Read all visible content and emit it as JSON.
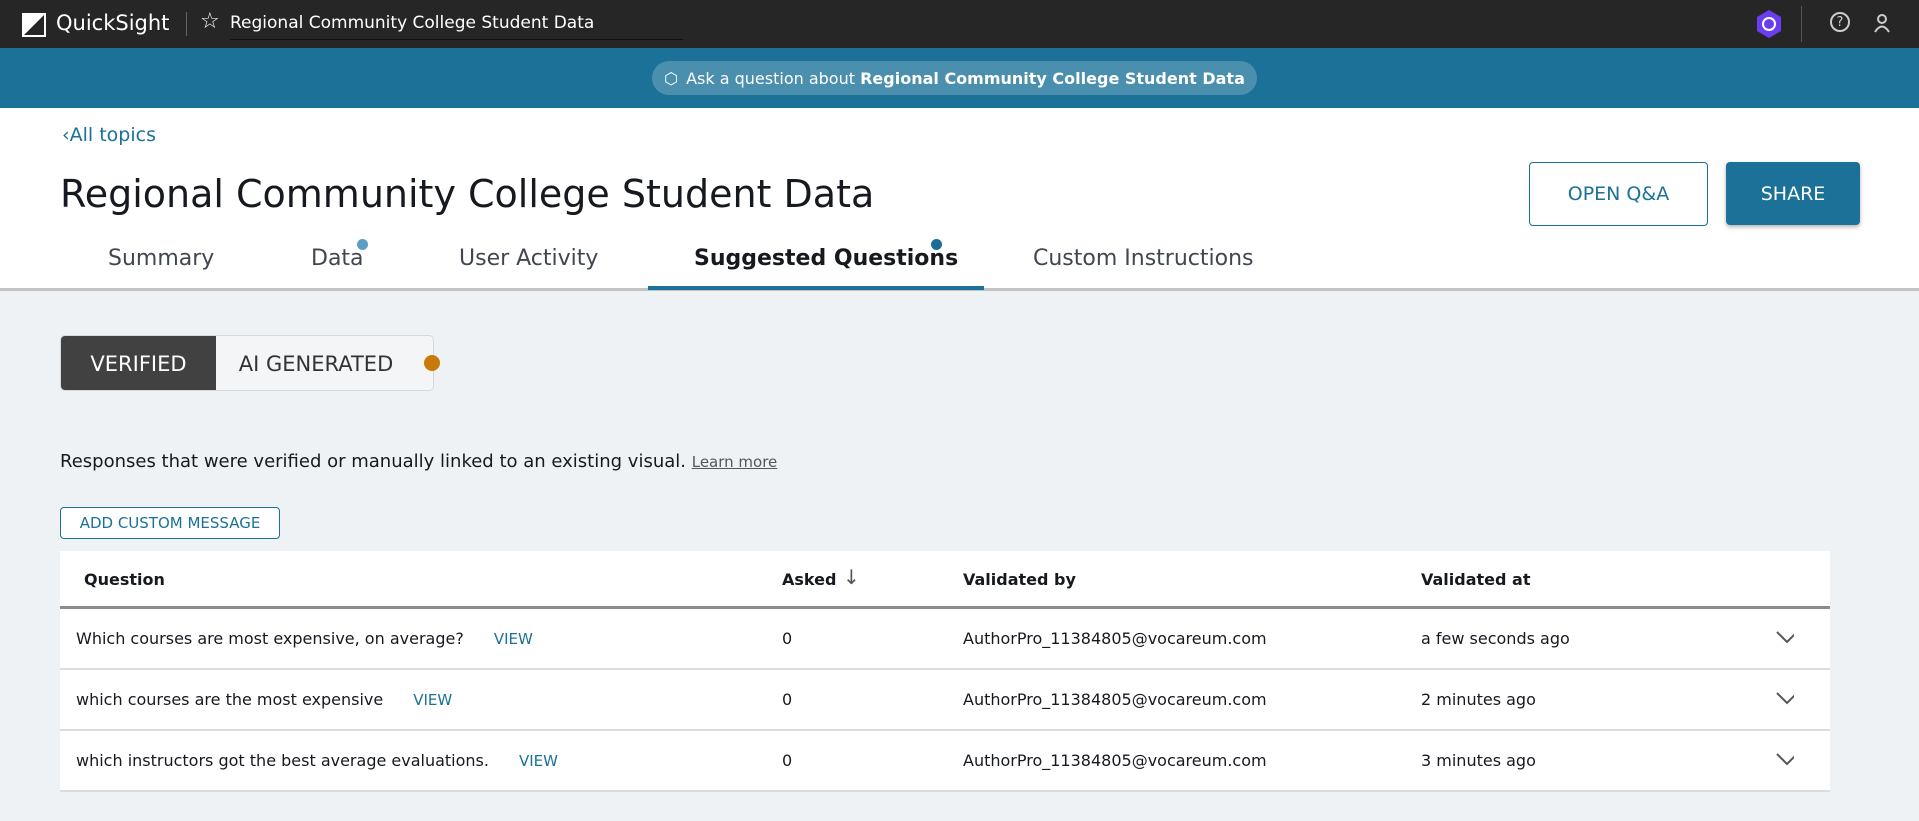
{
  "topbar": {
    "app_name": "QuickSight",
    "doc_title": "Regional Community College Student Data"
  },
  "banner": {
    "prefix": "Ask a question about ",
    "topic": "Regional Community College Student Data"
  },
  "back_link": "All topics",
  "page_title": "Regional Community College Student Data",
  "buttons": {
    "open_qa": "OPEN Q&A",
    "share": "SHARE"
  },
  "tabs": [
    {
      "label": "Summary"
    },
    {
      "label": "Data"
    },
    {
      "label": "User Activity"
    },
    {
      "label": "Suggested Questions",
      "active": true
    },
    {
      "label": "Custom Instructions"
    }
  ],
  "toggle": {
    "verified": "VERIFIED",
    "ai_generated": "AI GENERATED"
  },
  "description": "Responses that were verified or manually linked to an existing visual.",
  "learn_more": "Learn more",
  "add_custom_message": "ADD CUSTOM MESSAGE",
  "table": {
    "headers": {
      "question": "Question",
      "asked": "Asked",
      "validated_by": "Validated by",
      "validated_at": "Validated at"
    },
    "view_label": "VIEW",
    "rows": [
      {
        "question": "Which courses are most expensive, on average?",
        "asked": "0",
        "validated_by": "AuthorPro_11384805@vocareum.com",
        "validated_at": "a few seconds ago"
      },
      {
        "question": "which courses are the most expensive",
        "asked": "0",
        "validated_by": "AuthorPro_11384805@vocareum.com",
        "validated_at": "2 minutes ago"
      },
      {
        "question": "which instructors got the best average evaluations.",
        "asked": "0",
        "validated_by": "AuthorPro_11384805@vocareum.com",
        "validated_at": "3 minutes ago"
      }
    ]
  },
  "colors": {
    "brand": "#1b7198",
    "topbar": "#262626",
    "ai_dot": "#c97a0a"
  }
}
